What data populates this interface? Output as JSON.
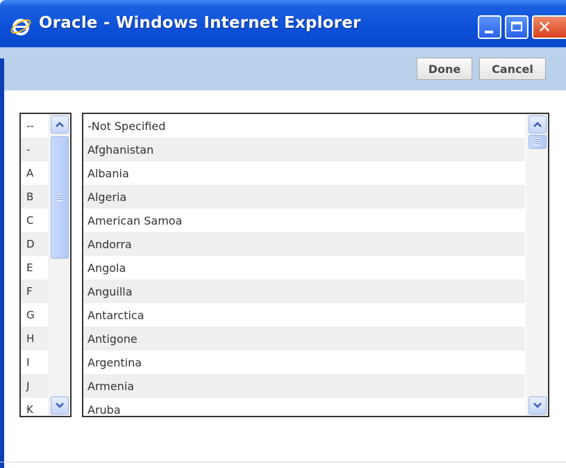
{
  "window": {
    "title": "Oracle - Windows Internet Explorer",
    "icon": "ie-icon",
    "controls": {
      "minimize": "minimize-icon",
      "maximize": "maximize-icon",
      "close": "✕"
    }
  },
  "toolbar": {
    "done_label": "Done",
    "cancel_label": "Cancel"
  },
  "index_list": {
    "items": [
      "--",
      "-",
      "A",
      "B",
      "C",
      "D",
      "E",
      "F",
      "G",
      "H",
      "I",
      "J",
      "K"
    ]
  },
  "country_list": {
    "items": [
      "-Not Specified",
      "Afghanistan",
      "Albania",
      "Algeria",
      "American Samoa",
      "Andorra",
      "Angola",
      "Anguilla",
      "Antarctica",
      "Antigone",
      "Argentina",
      "Armenia",
      "Aruba"
    ]
  },
  "colors": {
    "titlebar": "#0b4ed6",
    "toolbar": "#b9d1ea",
    "alt_row": "#efefef",
    "close_button": "#d9401c"
  }
}
